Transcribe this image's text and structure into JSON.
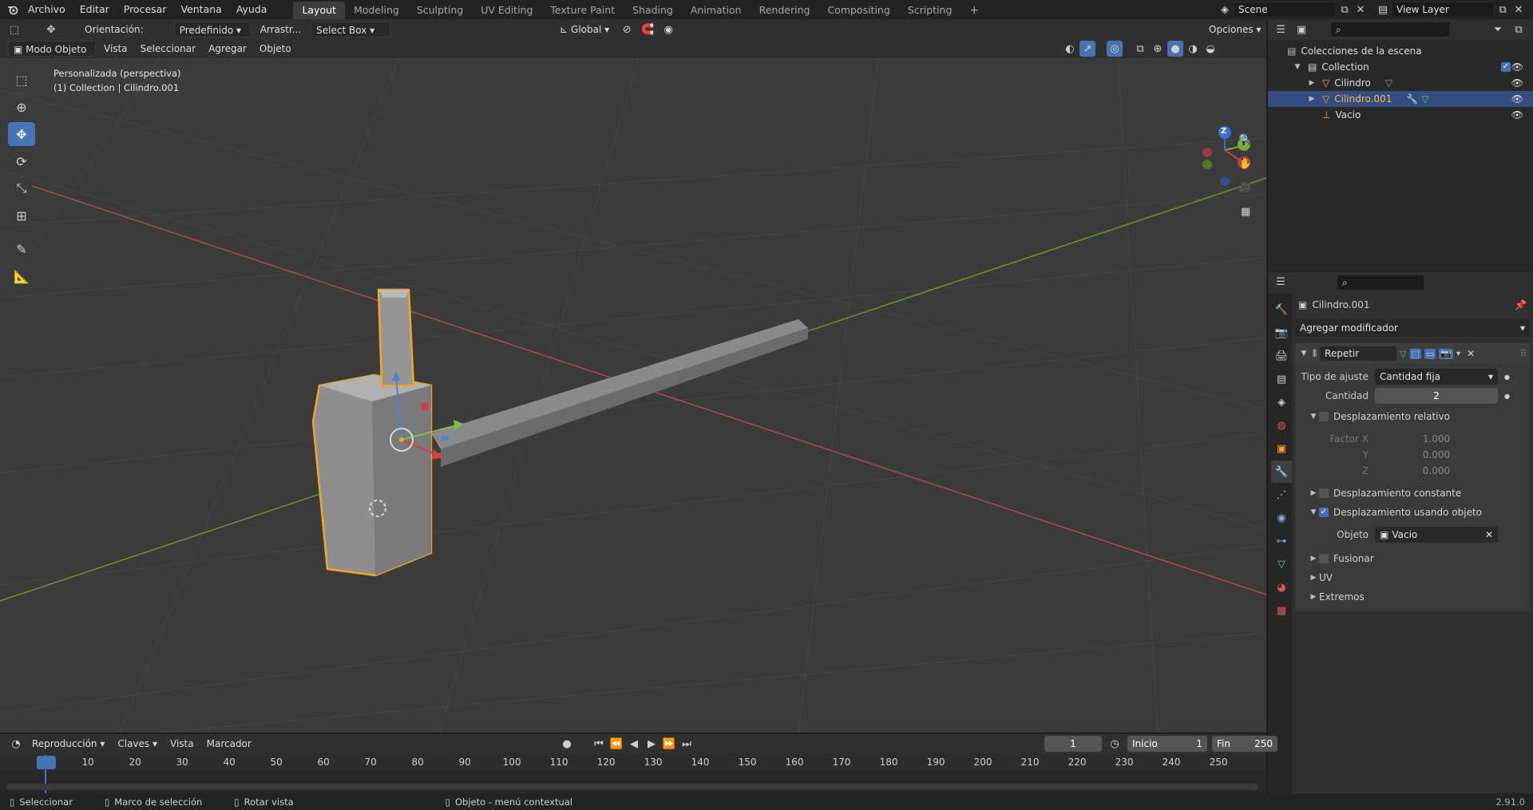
{
  "topbar": {
    "menus": [
      "Archivo",
      "Editar",
      "Procesar",
      "Ventana",
      "Ayuda"
    ],
    "workspaces": [
      "Layout",
      "Modeling",
      "Sculpting",
      "UV Editing",
      "Texture Paint",
      "Shading",
      "Animation",
      "Rendering",
      "Compositing",
      "Scripting"
    ],
    "active_workspace": "Layout",
    "scene": "Scene",
    "view_layer": "View Layer"
  },
  "viewport_header": {
    "orientation_label": "Orientación:",
    "orientation_value": "Predefinido",
    "drag_label": "Arrastr...",
    "select_mode": "Select Box",
    "transform_space": "Global",
    "options": "Opciones",
    "mode": "Modo Objeto",
    "menus": [
      "Vista",
      "Seleccionar",
      "Agregar",
      "Objeto"
    ]
  },
  "viewport": {
    "view_name": "Personalizada (perspectiva)",
    "view_info": "(1) Collection | Cilindro.001",
    "gizmo_axes": [
      "Z",
      "Y",
      "X"
    ]
  },
  "outliner": {
    "root": "Colecciones de la escena",
    "collection": "Collection",
    "items": [
      {
        "name": "Cilindro",
        "selected": false
      },
      {
        "name": "Cilindro.001",
        "selected": true
      },
      {
        "name": "Vacio",
        "selected": false
      }
    ]
  },
  "properties": {
    "object_name": "Cilindro.001",
    "add_modifier": "Agregar modificador",
    "modifier_name": "Repetir",
    "fit_type_label": "Tipo de ajuste",
    "fit_type_value": "Cantidad fija",
    "count_label": "Cantidad",
    "count_value": "2",
    "relative_offset": "Desplazamiento relativo",
    "factor_x_label": "Factor X",
    "factor_x": "1.000",
    "factor_y_label": "Y",
    "factor_y": "0.000",
    "factor_z_label": "Z",
    "factor_z": "0.000",
    "constant_offset": "Desplazamiento constante",
    "object_offset": "Desplazamiento usando objeto",
    "object_label": "Objeto",
    "object_value": "Vacio",
    "merge": "Fusionar",
    "uv": "UV",
    "caps": "Extremos"
  },
  "timeline": {
    "menus": [
      "Reproducción",
      "Claves",
      "Vista",
      "Marcador"
    ],
    "current_frame": "1",
    "start_label": "Inicio",
    "start": "1",
    "end_label": "Fin",
    "end": "250",
    "frame_labels": [
      "1",
      "10",
      "20",
      "30",
      "40",
      "50",
      "60",
      "70",
      "80",
      "90",
      "100",
      "110",
      "120",
      "130",
      "140",
      "150",
      "160",
      "170",
      "180",
      "190",
      "200",
      "210",
      "220",
      "230",
      "240",
      "250"
    ]
  },
  "statusbar": {
    "select": "Seleccionar",
    "box_select": "Marco de selección",
    "rotate": "Rotar vista",
    "context_menu": "Objeto - menú contextual",
    "version": "2.91.0"
  },
  "colors": {
    "accent": "#4772b3",
    "selection_outline": "#f5a623",
    "x_axis": "#c04545",
    "y_axis": "#7bab3a",
    "z_axis": "#3b6fd1"
  }
}
